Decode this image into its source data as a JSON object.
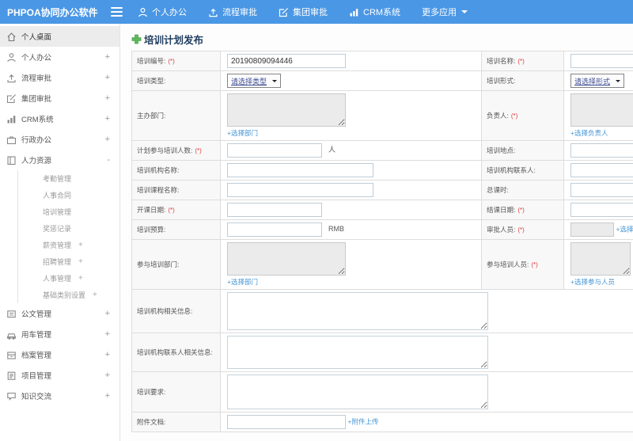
{
  "colors": {
    "header_blue": "#4a97e5",
    "link_blue": "#4596d6",
    "add_green": "#5cb85c",
    "required_red": "#e23c3c"
  },
  "header": {
    "logo": "PHPOA协同办公软件",
    "nav": [
      {
        "label": "个人办公",
        "icon": "user-icon"
      },
      {
        "label": "流程审批",
        "icon": "upload-icon"
      },
      {
        "label": "集团审批",
        "icon": "edit-icon"
      },
      {
        "label": "CRM系统",
        "icon": "chart-icon"
      },
      {
        "label": "更多应用",
        "icon": "caret-down-icon"
      }
    ]
  },
  "sidebar": {
    "items": [
      {
        "label": "个人桌面",
        "icon": "home-icon",
        "expand": "",
        "active": true
      },
      {
        "label": "个人办公",
        "icon": "user-icon",
        "expand": "+"
      },
      {
        "label": "流程审批",
        "icon": "upload-icon",
        "expand": "+"
      },
      {
        "label": "集团审批",
        "icon": "edit-icon",
        "expand": "+"
      },
      {
        "label": "CRM系统",
        "icon": "chart-icon",
        "expand": "+"
      },
      {
        "label": "行政办公",
        "icon": "briefcase-icon",
        "expand": "+"
      },
      {
        "label": "人力资源",
        "icon": "book-icon",
        "expand": "-"
      },
      {
        "label": "公文管理",
        "icon": "document-icon",
        "expand": "+"
      },
      {
        "label": "用车管理",
        "icon": "car-icon",
        "expand": "+"
      },
      {
        "label": "档案管理",
        "icon": "archive-icon",
        "expand": "+"
      },
      {
        "label": "项目管理",
        "icon": "project-icon",
        "expand": "+"
      },
      {
        "label": "知识交流",
        "icon": "chat-icon",
        "expand": "+"
      }
    ],
    "hr_children": [
      {
        "label": "考勤管理",
        "expand": ""
      },
      {
        "label": "人事合同",
        "expand": ""
      },
      {
        "label": "培训管理",
        "expand": ""
      },
      {
        "label": "奖惩记录",
        "expand": ""
      },
      {
        "label": "薪资管理",
        "expand": "+"
      },
      {
        "label": "招聘管理",
        "expand": "+"
      },
      {
        "label": "人事管理",
        "expand": "+"
      },
      {
        "label": "基础类别设置",
        "expand": "+"
      }
    ]
  },
  "main": {
    "title": "培训计划发布",
    "required_marker": "(*)",
    "fields": {
      "number": {
        "label": "培训编号:",
        "value": "20190809094446"
      },
      "name": {
        "label": "培训名称:"
      },
      "type": {
        "label": "培训类型:",
        "placeholder": "请选择类型"
      },
      "mode": {
        "label": "培训形式:",
        "placeholder": "请选择形式"
      },
      "host_dept": {
        "label": "主办部门:",
        "link": "+选择部门"
      },
      "leader": {
        "label": "负责人:",
        "link": "+选择负责人"
      },
      "count": {
        "label": "计划参与培训人数:",
        "unit": "人"
      },
      "location": {
        "label": "培训地点:"
      },
      "org_name": {
        "label": "培训机构名称:"
      },
      "org_contact": {
        "label": "培训机构联系人:"
      },
      "course_name": {
        "label": "培训课程名称:"
      },
      "hours": {
        "label": "总课时:"
      },
      "start_date": {
        "label": "开课日期:"
      },
      "end_date": {
        "label": "结课日期:"
      },
      "budget": {
        "label": "培训预算:",
        "unit": "RMB"
      },
      "approver": {
        "label": "审批人员:",
        "link": "+选择审批人员"
      },
      "part_dept": {
        "label": "参与培训部门:",
        "link": "+选择部门"
      },
      "part_people": {
        "label": "参与培训人员:",
        "link": "+选择参与人员"
      },
      "org_info": {
        "label": "培训机构相关信息:"
      },
      "org_contact_info": {
        "label": "培训机构联系人相关信息:"
      },
      "requirements": {
        "label": "培训要求:"
      },
      "attachment": {
        "label": "附件文档:",
        "link": "+附件上传"
      }
    }
  }
}
